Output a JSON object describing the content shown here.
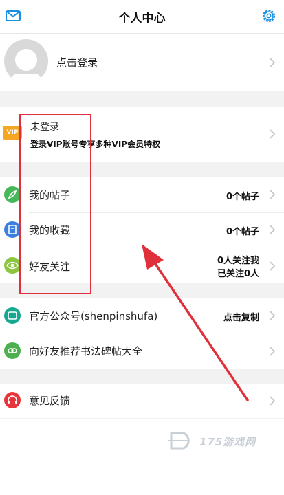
{
  "header": {
    "title": "个人中心"
  },
  "login": {
    "label": "点击登录"
  },
  "vip": {
    "badge": "VIP",
    "status": "未登录",
    "desc": "登录VIP账号专享多种VIP会员特权"
  },
  "menu": [
    {
      "label": "我的帖子",
      "value": "0个帖子"
    },
    {
      "label": "我的收藏",
      "value": "0个帖子"
    },
    {
      "label": "好友关注",
      "value_line1": "0人关注我",
      "value_line2": "已关注0人"
    }
  ],
  "social": [
    {
      "label": "官方公众号(shenpinshufa)",
      "value": "点击复制"
    },
    {
      "label": "向好友推荐书法碑帖大全"
    }
  ],
  "feedback": {
    "label": "意见反馈"
  },
  "watermark": "175游戏网",
  "colors": {
    "accent": "#1a8fe3",
    "annotation": "#e0303a",
    "vip": "#f5a623",
    "posts": "#47b85a",
    "favorites": "#3d7fe0",
    "follow": "#8cc63f",
    "official": "#17a98f",
    "share": "#4cb050",
    "feedback": "#e8343d"
  },
  "icons": {
    "mail": "mail-icon",
    "settings": "gear-icon",
    "posts": "feather-icon",
    "favorites": "bookmark-icon",
    "follow": "eye-icon",
    "official": "chat-icon",
    "share": "link-icon",
    "feedback": "headset-icon"
  }
}
